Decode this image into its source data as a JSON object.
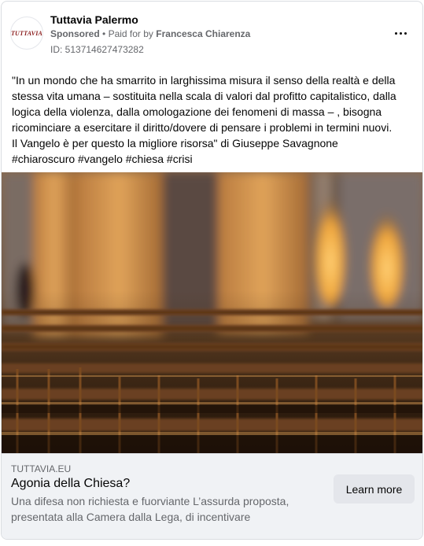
{
  "header": {
    "avatar_logo_text": "TUTTAVIA",
    "page_name": "Tuttavia Palermo",
    "sponsored_label": "Sponsored",
    "separator": "•",
    "paid_for_label": "Paid for by",
    "payer_name": "Francesca Chiarenza",
    "ad_id": "ID: 513714627473282",
    "more_icon": "more-horizontal-icon"
  },
  "post": {
    "lines": [
      "\"In un mondo che ha smarrito in larghissima misura il senso della realtà e della stessa vita umana – sostituita nella scala di valori dal profitto capitalistico, dalla logica della violenza, dalla omologazione dei fenomeni di massa – , bisogna ricominciare a esercitare il diritto/dovere di pensare i problemi in termini nuovi.",
      "Il Vangelo è per questo la migliore risorsa\" di Giuseppe Savagnone"
    ],
    "hashtags": [
      "#chiaroscuro",
      "#vangelo",
      "#chiesa",
      "#crisi"
    ]
  },
  "photo": {
    "description_icon": "church-pews-photo"
  },
  "link": {
    "domain": "TUTTAVIA.EU",
    "title": "Agonia della Chiesa?",
    "description": "Una difesa non richiesta e fuorviante L’assurda proposta, presentata alla Camera dalla Lega, di incentivare",
    "cta_label": "Learn more"
  },
  "colors": {
    "text_primary": "#050505",
    "text_secondary": "#65676b",
    "link_background": "#f0f2f5",
    "button_background": "#e4e6eb",
    "card_border": "#dadde1"
  }
}
